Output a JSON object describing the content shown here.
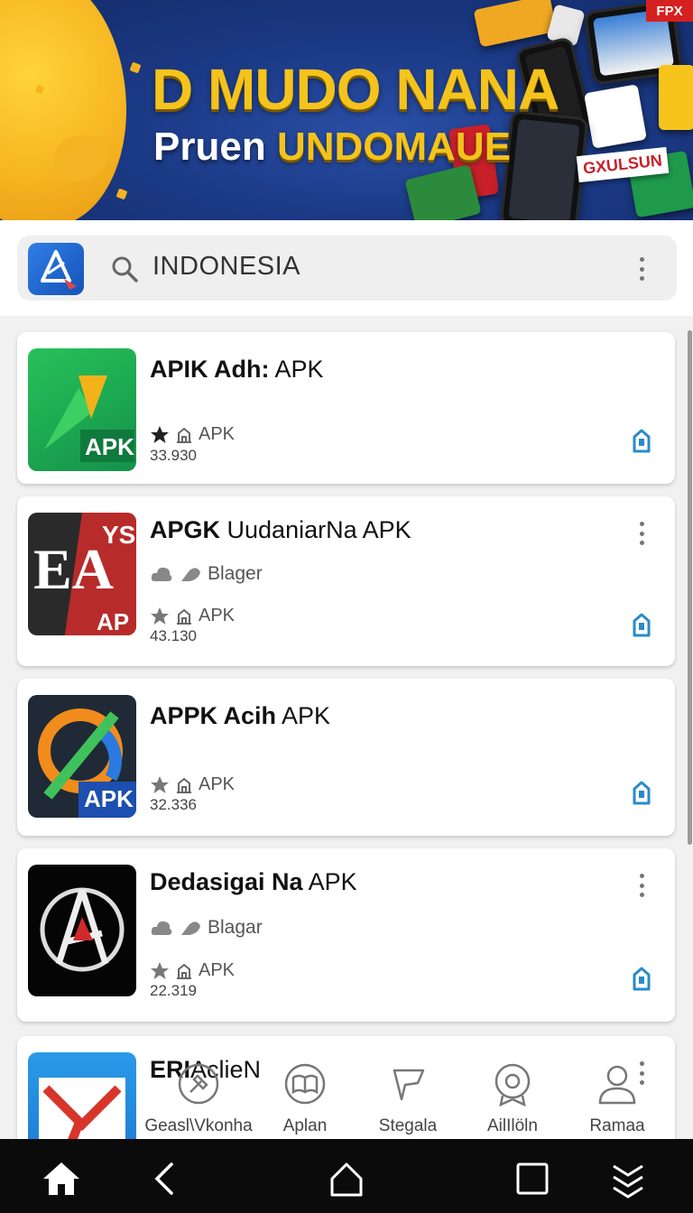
{
  "banner": {
    "title": "D MUDO NANA",
    "subtitle_white": "Pruen",
    "subtitle_yellow": "UNDOMAUE",
    "corner_badge": "FPX",
    "sticker": "GXULSUN"
  },
  "search": {
    "value": "INDONESIA"
  },
  "apps": [
    {
      "title_bold": "APIK Adh:",
      "title_rest": " APK",
      "category": "",
      "tag": "APK",
      "count": "33.930",
      "thumb": "green"
    },
    {
      "title_bold": "APGK",
      "title_rest": "  UudaniarNa APK",
      "category": "Blager",
      "tag": "APK",
      "count": "43.130",
      "thumb": "ea"
    },
    {
      "title_bold": "APPK Acih",
      "title_rest": " APK",
      "category": "",
      "tag": "APK",
      "count": "32.336",
      "thumb": "swirl"
    },
    {
      "title_bold": "Dedasigai Na",
      "title_rest": " APK",
      "category": "Blagar",
      "tag": "APK",
      "count": "22.319",
      "thumb": "black"
    },
    {
      "title_bold": "ERI",
      "title_rest": "AclieN",
      "category": "",
      "tag": "",
      "count": "",
      "thumb": "blue"
    }
  ],
  "tabs": [
    {
      "label": "Geasl\\Vkonha",
      "icon": "hammer-icon"
    },
    {
      "label": "Aplan",
      "icon": "book-icon"
    },
    {
      "label": "Stegala",
      "icon": "flag-icon"
    },
    {
      "label": "AilIlöln",
      "icon": "badge-icon"
    },
    {
      "label": "Ramaa",
      "icon": "person-icon"
    }
  ],
  "colors": {
    "accent": "#2a8ac9",
    "banner_blue": "#1b3a86",
    "banner_gold": "#f4c31c",
    "nav_bg": "#0b0b0b"
  }
}
